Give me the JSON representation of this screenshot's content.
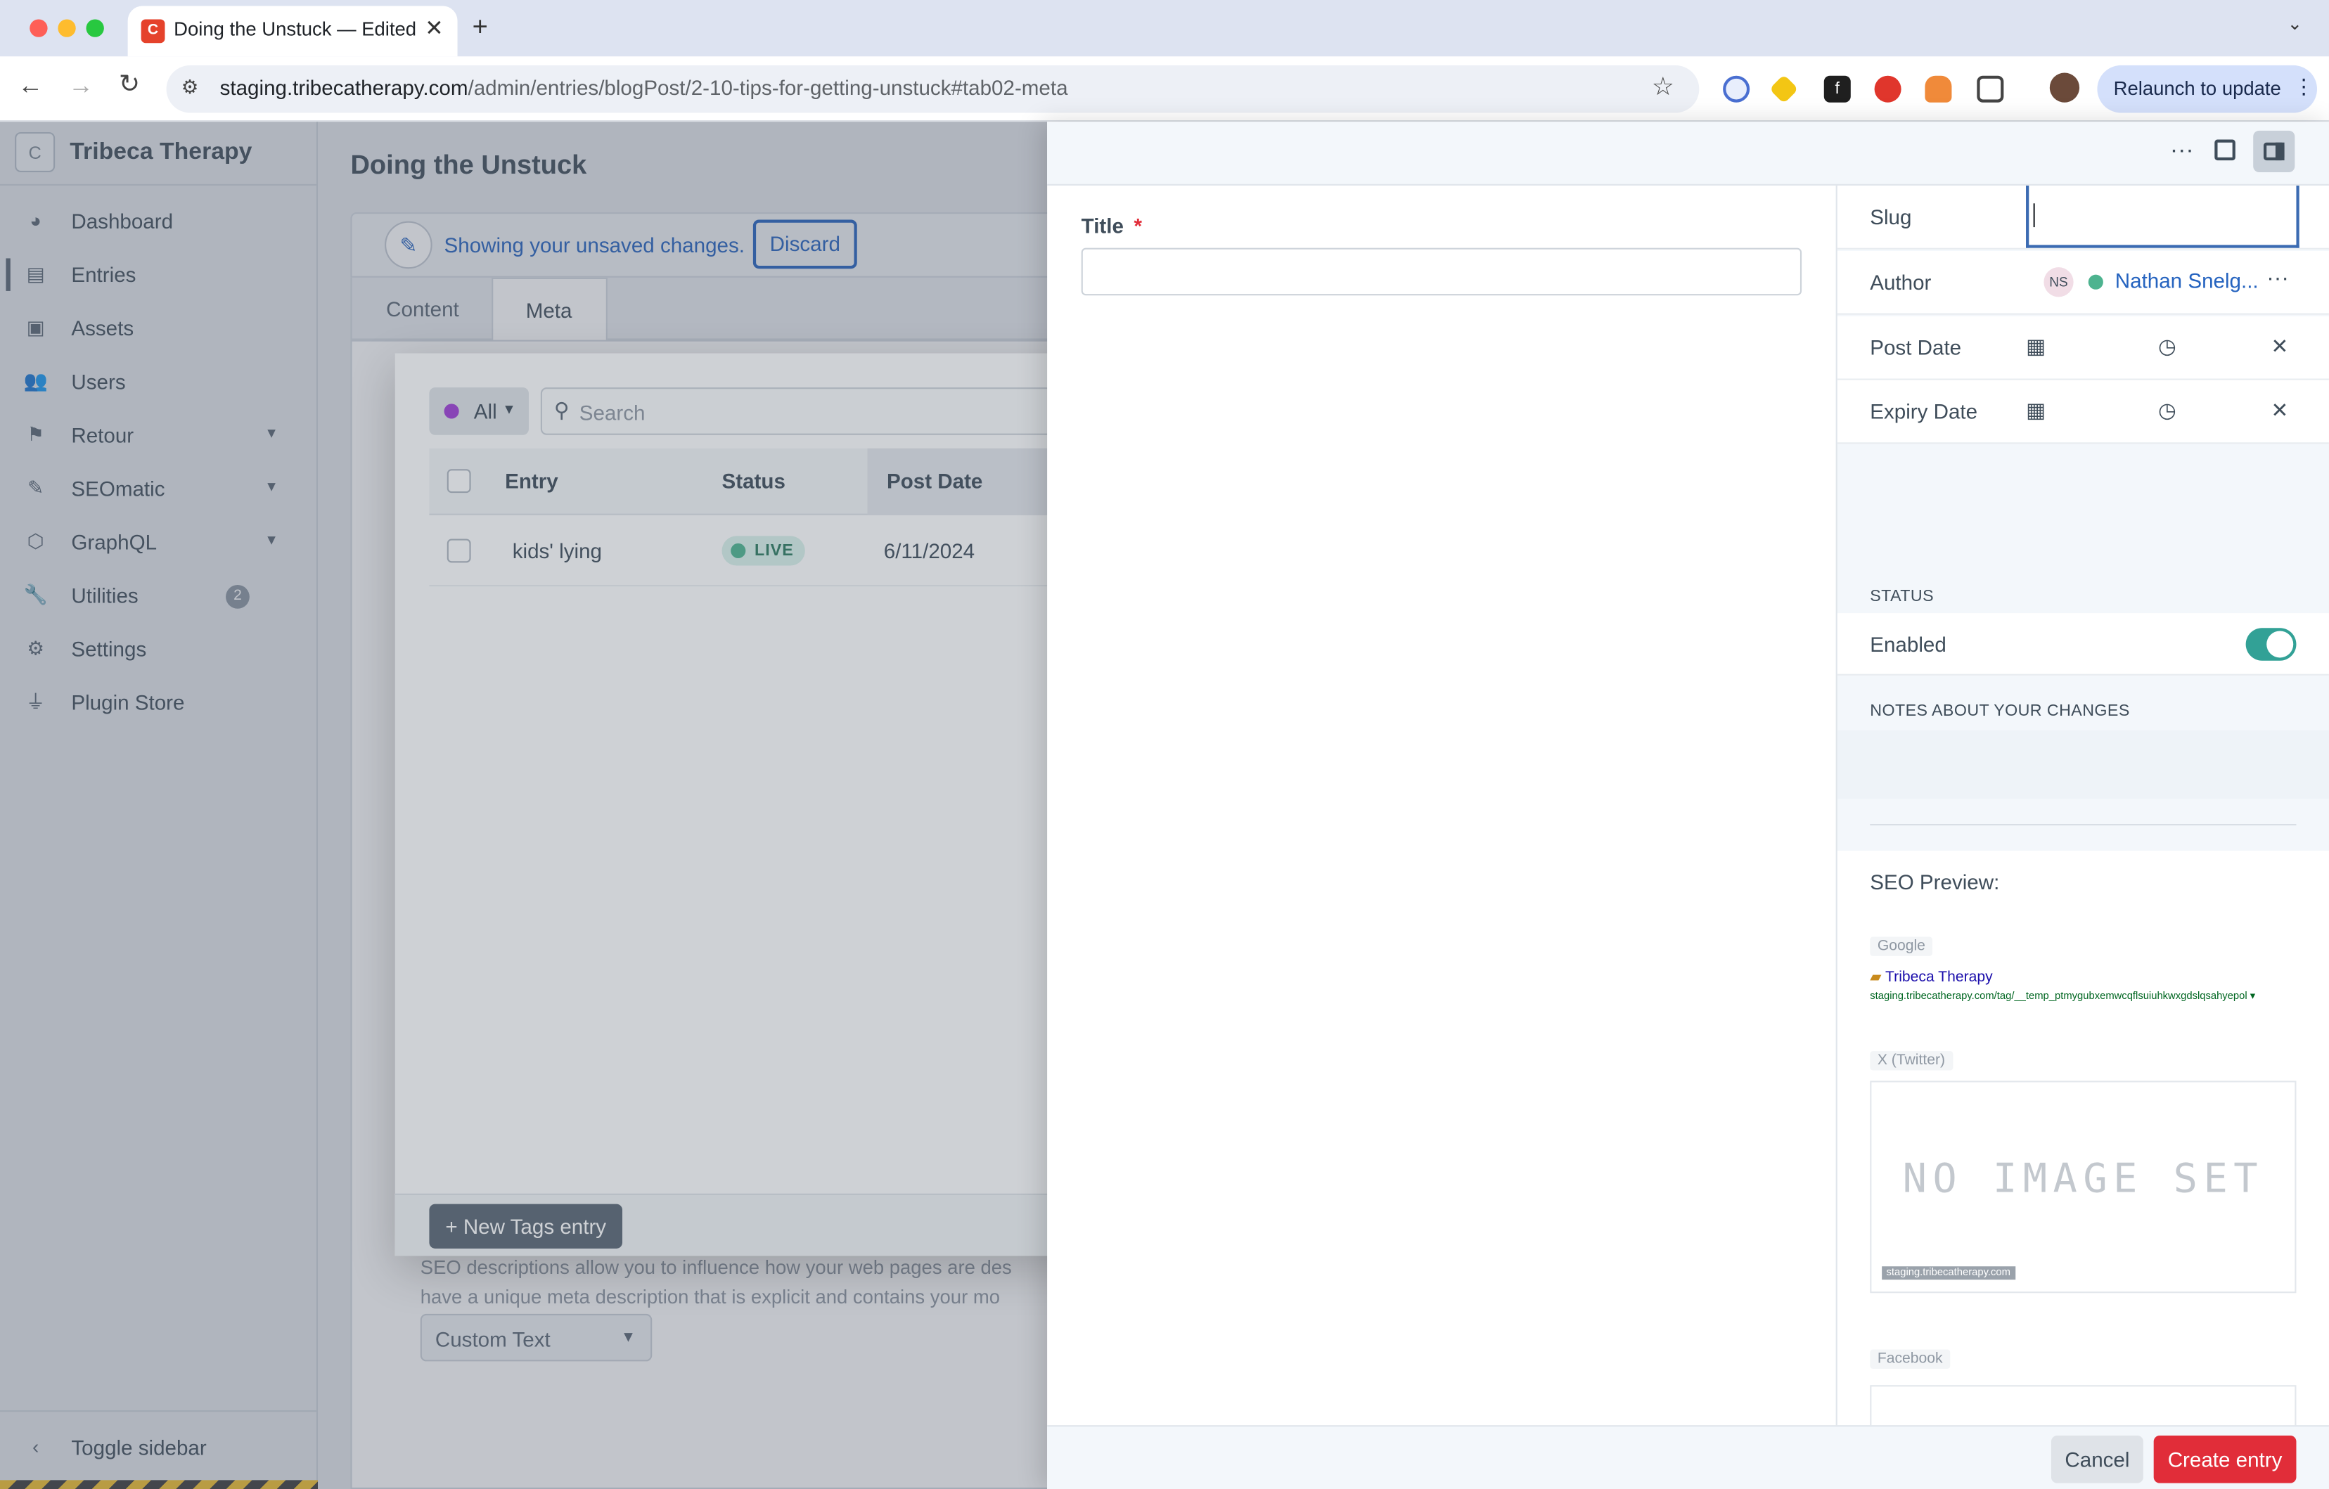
{
  "browser": {
    "tab_title": "Doing the Unstuck — Edited",
    "tab_favicon": "C",
    "new_tab": "+",
    "url_domain": "staging.tribecatherapy.com",
    "url_path": "/admin/entries/blogPost/2-10-tips-for-getting-unstuck#tab02-meta",
    "relaunch_label": "Relaunch to update"
  },
  "sidebar": {
    "logo": "C",
    "site_name": "Tribeca Therapy",
    "items": [
      {
        "label": "Dashboard",
        "icon": "gauge-icon"
      },
      {
        "label": "Entries",
        "icon": "newspaper-icon"
      },
      {
        "label": "Assets",
        "icon": "image-icon"
      },
      {
        "label": "Users",
        "icon": "users-icon"
      },
      {
        "label": "Retour",
        "icon": "signpost-icon"
      },
      {
        "label": "SEOmatic",
        "icon": "seo-icon"
      },
      {
        "label": "GraphQL",
        "icon": "graphql-icon"
      },
      {
        "label": "Utilities",
        "icon": "wrench-icon",
        "badge": "2"
      },
      {
        "label": "Settings",
        "icon": "gear-icon"
      },
      {
        "label": "Plugin Store",
        "icon": "plug-icon"
      }
    ],
    "toggle_label": "Toggle sidebar"
  },
  "main": {
    "page_title": "Doing the Unstuck",
    "notice": "Showing your unsaved changes.",
    "discard_label": "Discard",
    "tabs": [
      {
        "label": "Content"
      },
      {
        "label": "Meta"
      }
    ],
    "bg_text_1": "SEO descriptions allow you to influence how your web pages are des",
    "bg_text_2": "have a unique meta description that is explicit and contains your mo",
    "custom_text_select": "Custom Text"
  },
  "modal": {
    "filter_label": "All",
    "search_placeholder": "Search",
    "columns": [
      "Entry",
      "Status",
      "Post Date"
    ],
    "rows": [
      {
        "entry": "kids' lying",
        "status": "LIVE",
        "post_date": "6/11/2024"
      }
    ],
    "new_entry_label": "+ New Tags entry"
  },
  "slideout": {
    "title_label": "Title",
    "required_mark": "*",
    "slug_label": "Slug",
    "author_label": "Author",
    "author_initials": "NS",
    "author_name": "Nathan Snelg...",
    "post_date_label": "Post Date",
    "expiry_date_label": "Expiry Date",
    "status_heading": "STATUS",
    "enabled_label": "Enabled",
    "enabled": true,
    "notes_heading": "NOTES ABOUT YOUR CHANGES",
    "seo_preview_label": "SEO Preview:",
    "google_label": "Google",
    "google_title": "Tribeca Therapy",
    "google_url": "staging.tribecatherapy.com/tag/__temp_ptmygubxemwcqflsuiuhkwxgdslqsahyepol ▾",
    "twitter_label": "X (Twitter)",
    "no_image_text": "NO IMAGE SET",
    "twitter_domain": "staging.tribecatherapy.com",
    "facebook_label": "Facebook",
    "cancel_label": "Cancel",
    "create_label": "Create entry"
  },
  "colors": {
    "accent_red": "#e12d39",
    "link_blue": "#2563bf",
    "toggle_teal": "#32a196",
    "live_green": "#4db38f"
  }
}
